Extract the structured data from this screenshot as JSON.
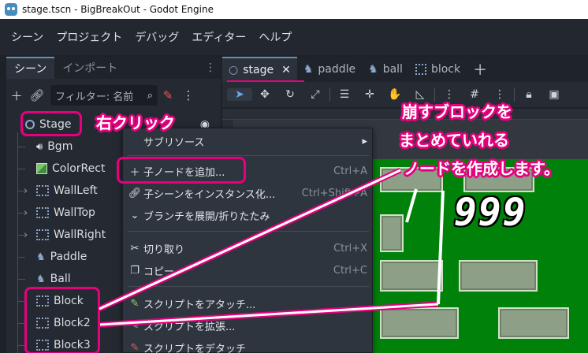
{
  "window": {
    "title": "stage.tscn - BigBreakOut - Godot Engine",
    "icon": "godot-logo-icon"
  },
  "menubar": [
    "シーン",
    "プロジェクト",
    "デバッグ",
    "エディター",
    "ヘルプ"
  ],
  "left_dock": {
    "tabs": [
      "シーン",
      "インポート"
    ],
    "filter_placeholder": "フィルター: 名前",
    "tree": [
      {
        "label": "Stage",
        "icon": "node2d-icon",
        "selected": true
      },
      {
        "label": "Bgm",
        "icon": "audio-stream-player-icon"
      },
      {
        "label": "ColorRect",
        "icon": "colorrect-icon"
      },
      {
        "label": "WallLeft",
        "icon": "node-box-icon",
        "expandable": true
      },
      {
        "label": "WallTop",
        "icon": "node-box-icon",
        "expandable": true
      },
      {
        "label": "WallRight",
        "icon": "node-box-icon",
        "expandable": true
      },
      {
        "label": "Paddle",
        "icon": "character-icon"
      },
      {
        "label": "Ball",
        "icon": "character-icon"
      },
      {
        "label": "Block",
        "icon": "node-box-icon"
      },
      {
        "label": "Block2",
        "icon": "node-box-icon"
      },
      {
        "label": "Block3",
        "icon": "node-box-icon"
      }
    ]
  },
  "editor_tabs": [
    {
      "label": "stage",
      "icon": "node2d-icon",
      "active": true,
      "closable": true
    },
    {
      "label": "paddle",
      "icon": "character-icon"
    },
    {
      "label": "ball",
      "icon": "character-icon"
    },
    {
      "label": "block",
      "icon": "node-box-icon"
    }
  ],
  "context_menu": {
    "items": [
      {
        "label": "サブリソース",
        "icon": "",
        "shortcut": "",
        "submenu": true
      },
      {
        "label": "子ノードを追加...",
        "icon": "plus-icon",
        "shortcut": "Ctrl+A"
      },
      {
        "label": "子シーンをインスタンス化...",
        "icon": "link-icon",
        "shortcut": "Ctrl+Shift+A"
      },
      {
        "label": "ブランチを展開/折りたたみ",
        "icon": "chevron-down-icon",
        "shortcut": ""
      },
      {
        "label": "切り取り",
        "icon": "scissors-icon",
        "shortcut": "Ctrl+X"
      },
      {
        "label": "コピー",
        "icon": "copy-icon",
        "shortcut": "Ctrl+C"
      },
      {
        "label": "スクリプトをアタッチ...",
        "icon": "script-attach-icon",
        "shortcut": ""
      },
      {
        "label": "スクリプトを拡張...",
        "icon": "script-extend-icon",
        "shortcut": ""
      },
      {
        "label": "スクリプトをデタッチ",
        "icon": "script-detach-icon",
        "shortcut": ""
      }
    ]
  },
  "viewport": {
    "score": "999"
  },
  "annotations": {
    "right_click": "右クリック",
    "note_line1": "崩すブロックを",
    "note_line2": "まとめていれる",
    "note_line3": "ノードを作成します。",
    "accent": "#e6007e"
  }
}
